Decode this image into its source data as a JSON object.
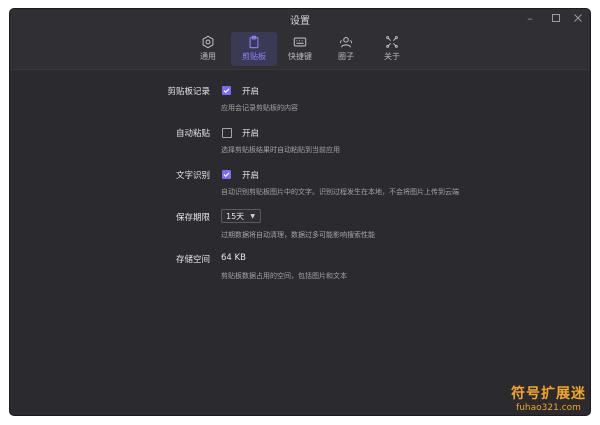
{
  "window": {
    "title": "设置"
  },
  "tabs": [
    {
      "label": "通用",
      "icon": "gear-icon"
    },
    {
      "label": "剪贴板",
      "icon": "clipboard-icon",
      "active": true
    },
    {
      "label": "快捷键",
      "icon": "keyboard-icon"
    },
    {
      "label": "圈子",
      "icon": "people-icon"
    },
    {
      "label": "关于",
      "icon": "info-icon"
    }
  ],
  "settings": {
    "clipboard_history": {
      "label": "剪贴板记录",
      "checked": true,
      "value": "开启",
      "description": "应用会记录剪贴板的内容"
    },
    "auto_paste": {
      "label": "自动粘贴",
      "checked": false,
      "value": "开启",
      "description": "选择剪贴板结果时自动粘贴到当前应用"
    },
    "ocr": {
      "label": "文字识别",
      "checked": true,
      "value": "开启",
      "description": "自动识别剪贴板图片中的文字。识别过程发生在本地，不会将图片上传到云端"
    },
    "retention": {
      "label": "保存期限",
      "selected": "15天",
      "description": "过期数据将自动清理，数据过多可能影响搜索性能"
    },
    "storage": {
      "label": "存储空间",
      "value": "64 KB",
      "description": "剪贴板数据占用的空间，包括图片和文本"
    }
  },
  "watermark": {
    "cn": "符号扩展迷",
    "en": "fuhao321.com"
  },
  "colors": {
    "accent": "#7b6cf6",
    "window_bg": "#2a2a2f",
    "watermark": "#f5a623"
  }
}
